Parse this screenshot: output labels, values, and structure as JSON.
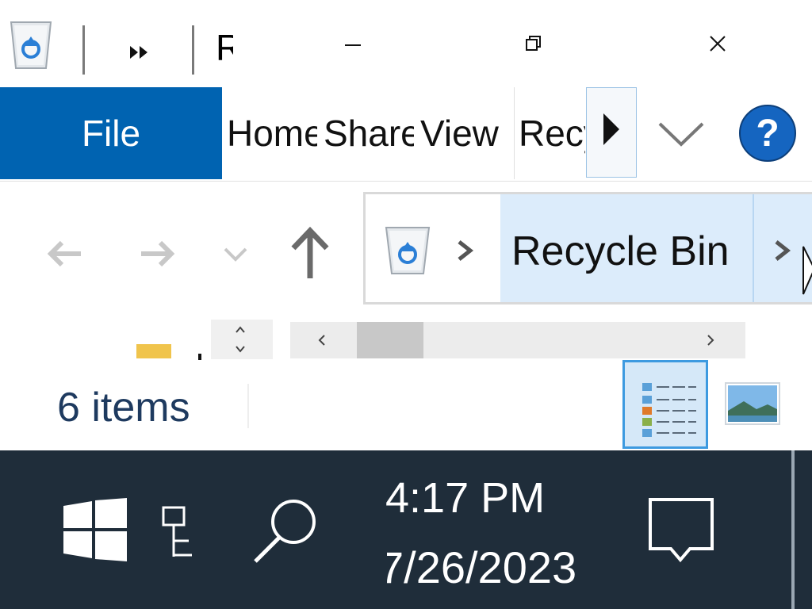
{
  "window": {
    "title": "R",
    "recycle_bin_icon": "recycle-bin-icon",
    "buttons": {
      "minimize": "minimize-icon",
      "restore": "restore-icon",
      "close": "close-icon"
    }
  },
  "ribbon": {
    "file_label": "File",
    "tabs": [
      {
        "label": "Home"
      },
      {
        "label": "Share"
      },
      {
        "label": "View"
      },
      {
        "label": "Recycle Bin Tools"
      }
    ],
    "help_label": "?",
    "accent_color": "#0063b1"
  },
  "address_bar": {
    "breadcrumb": "Recycle Bin"
  },
  "status_bar": {
    "item_count": "6 items"
  },
  "taskbar": {
    "time": "4:17 PM",
    "date": "7/26/2023",
    "background_color": "#1f2d3a"
  }
}
